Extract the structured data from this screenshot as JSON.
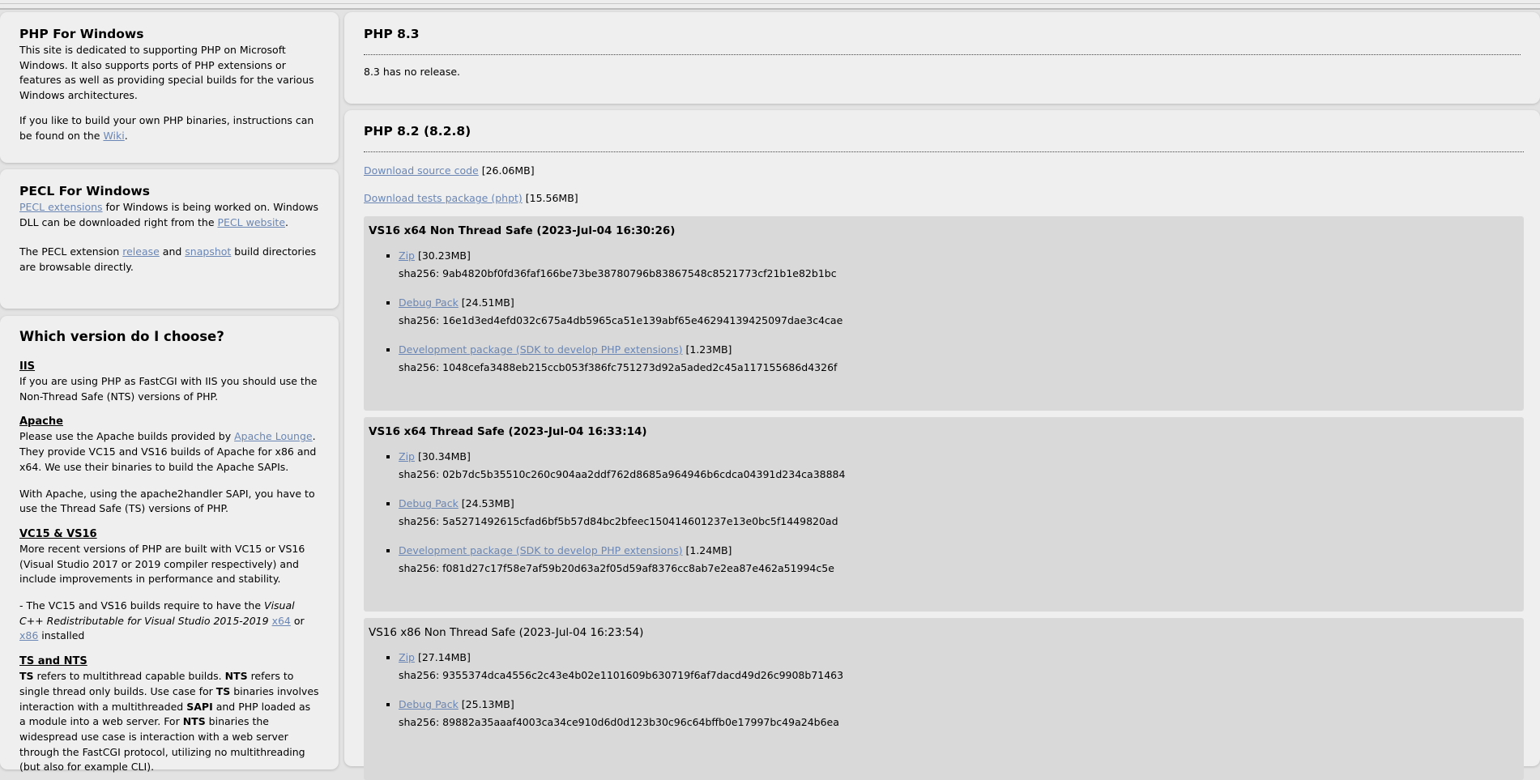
{
  "left": {
    "php_windows": {
      "title": "PHP For Windows",
      "p1": "This site is dedicated to supporting PHP on Microsoft Windows. It also supports ports of PHP extensions or features as well as providing special builds for the various Windows architectures.",
      "p2_before": "If you like to build your own PHP binaries, instructions can be found on the ",
      "p2_link": "Wiki",
      "p2_after": "."
    },
    "pecl": {
      "title": "PECL For Windows",
      "p1_link": "PECL extensions",
      "p1_mid": " for Windows is being worked on. Windows DLL can be downloaded right from the ",
      "p1_link2": "PECL website",
      "p1_after": ".",
      "p2_before": "The PECL extension ",
      "p2_link1": "release",
      "p2_mid": " and ",
      "p2_link2": "snapshot",
      "p2_after": " build directories are browsable directly."
    },
    "choose": {
      "title": "Which version do I choose?",
      "iis_heading": "IIS",
      "iis_text": "If you are using PHP as FastCGI with IIS you should use the Non-Thread Safe (NTS) versions of PHP.",
      "apache_heading": "Apache",
      "apache_p1_before": "Please use the Apache builds provided by ",
      "apache_p1_link": "Apache Lounge",
      "apache_p1_after": ". They provide VC15 and VS16 builds of Apache for x86 and x64. We use their binaries to build the Apache SAPIs.",
      "apache_p2": "With Apache, using the apache2handler SAPI, you have to use the Thread Safe (TS) versions of PHP.",
      "vc_heading": "VC15 & VS16",
      "vc_p1": "More recent versions of PHP are built with VC15 or VS16 (Visual Studio 2017 or 2019 compiler respectively) and include improvements in performance and stability.",
      "vc_p2_before": "- The VC15 and VS16 builds require to have the ",
      "vc_p2_em": "Visual C++ Redistributable for Visual Studio 2015-2019",
      "vc_p2_link1": "x64",
      "vc_p2_or": " or ",
      "vc_p2_link2": "x86",
      "vc_p2_after": " installed",
      "ts_heading": "TS and NTS",
      "ts_b1": "TS",
      "ts_t1": " refers to multithread capable builds. ",
      "ts_b2": "NTS",
      "ts_t2": " refers to single thread only builds. Use case for ",
      "ts_b3": "TS",
      "ts_t3": " binaries involves interaction with a multithreaded ",
      "ts_b4": "SAPI",
      "ts_t4": " and PHP loaded as a module into a web server. For ",
      "ts_b5": "NTS",
      "ts_t5": " binaries the widespread use case is interaction with a web server through the FastCGI protocol, utilizing no multithreading (but also for example CLI)."
    }
  },
  "php83": {
    "title": "PHP 8.3",
    "text": "8.3 has no release."
  },
  "php82": {
    "title": "PHP 8.2 (8.2.8)",
    "source_link": "Download source code",
    "source_size": " [26.06MB]",
    "tests_link": "Download tests package (phpt)",
    "tests_size": " [15.56MB]",
    "builds": [
      {
        "title": "VS16 x64 Non Thread Safe (2023-Jul-04 16:30:26)",
        "items": [
          {
            "link": "Zip",
            "size": " [30.23MB]",
            "sha": "sha256: 9ab4820bf0fd36faf166be73be38780796b83867548c8521773cf21b1e82b1bc"
          },
          {
            "link": "Debug Pack",
            "size": " [24.51MB]",
            "sha": "sha256: 16e1d3ed4efd032c675a4db5965ca51e139abf65e46294139425097dae3c4cae"
          },
          {
            "link": "Development package (SDK to develop PHP extensions)",
            "size": " [1.23MB]",
            "sha": "sha256: 1048cefa3488eb215ccb053f386fc751273d92a5aded2c45a117155686d4326f"
          }
        ]
      },
      {
        "title": "VS16 x64 Thread Safe (2023-Jul-04 16:33:14)",
        "items": [
          {
            "link": "Zip",
            "size": " [30.34MB]",
            "sha": "sha256: 02b7dc5b35510c260c904aa2ddf762d8685a964946b6cdca04391d234ca38884"
          },
          {
            "link": "Debug Pack",
            "size": " [24.53MB]",
            "sha": "sha256: 5a5271492615cfad6bf5b57d84bc2bfeec150414601237e13e0bc5f1449820ad"
          },
          {
            "link": "Development package (SDK to develop PHP extensions)",
            "size": " [1.24MB]",
            "sha": "sha256: f081d27c17f58e7af59b20d63a2f05d59af8376cc8ab7e2ea87e462a51994c5e"
          }
        ]
      },
      {
        "title": "VS16 x86 Non Thread Safe (2023-Jul-04 16:23:54)",
        "items": [
          {
            "link": "Zip",
            "size": " [27.14MB]",
            "sha": "sha256: 9355374dca4556c2c43e4b02e1101609b630719f6af7dacd49d26c9908b71463"
          },
          {
            "link": "Debug Pack",
            "size": " [25.13MB]",
            "sha": "sha256: 89882a35aaaf4003ca34ce910d6d0d123b30c96c64bffb0e17997bc49a24b6ea"
          }
        ]
      }
    ]
  }
}
